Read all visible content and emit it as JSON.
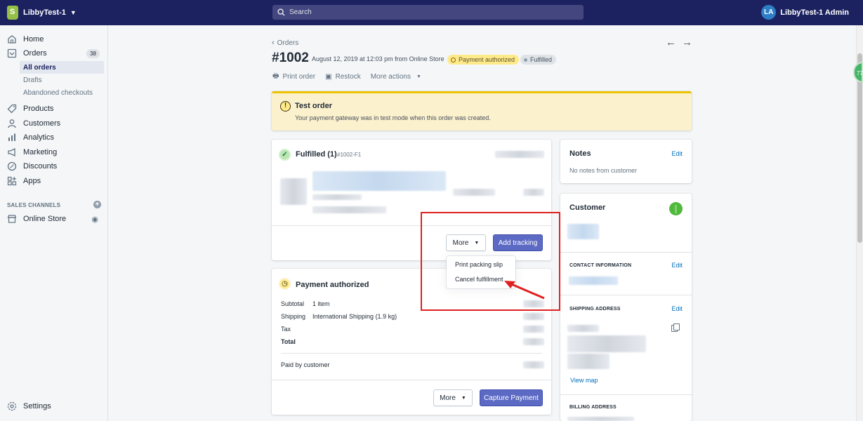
{
  "topbar": {
    "store_name": "LibbyTest-1",
    "search_placeholder": "Search",
    "user_initials": "LA",
    "user_name": "LibbyTest-1 Admin"
  },
  "sidebar": {
    "home": "Home",
    "orders": "Orders",
    "orders_count": "38",
    "all_orders": "All orders",
    "drafts": "Drafts",
    "abandoned": "Abandoned checkouts",
    "products": "Products",
    "customers": "Customers",
    "analytics": "Analytics",
    "marketing": "Marketing",
    "discounts": "Discounts",
    "apps": "Apps",
    "sales_channels": "SALES CHANNELS",
    "online_store": "Online Store",
    "settings": "Settings"
  },
  "header": {
    "breadcrumb": "Orders",
    "order_number": "#1002",
    "order_meta": "August 12, 2019 at 12:03 pm from Online Store",
    "payment_status": "Payment authorized",
    "fulfillment_status": "Fulfilled",
    "print_order": "Print order",
    "restock": "Restock",
    "more_actions": "More actions"
  },
  "test_banner": {
    "title": "Test order",
    "text": "Your payment gateway was in test mode when this order was created."
  },
  "fulfilled_card": {
    "title": "Fulfilled (1)",
    "id": "#1002-F1",
    "more_label": "More",
    "add_tracking": "Add tracking",
    "dropdown_items": [
      "Print packing slip",
      "Cancel fulfillment"
    ]
  },
  "payment_card": {
    "title": "Payment authorized",
    "rows": [
      {
        "label": "Subtotal",
        "value": "1 item"
      },
      {
        "label": "Shipping",
        "value": "International Shipping (1.9 kg)"
      },
      {
        "label": "Tax",
        "value": ""
      },
      {
        "label": "Total",
        "value": ""
      }
    ],
    "paid_by": "Paid by customer",
    "more_label": "More",
    "capture": "Capture Payment"
  },
  "notes_card": {
    "title": "Notes",
    "edit": "Edit",
    "empty": "No notes from customer"
  },
  "customer_card": {
    "title": "Customer",
    "contact_heading": "CONTACT INFORMATION",
    "contact_edit": "Edit",
    "shipping_heading": "SHIPPING ADDRESS",
    "shipping_edit": "Edit",
    "view_map": "View map",
    "billing_heading": "BILLING ADDRESS"
  },
  "colors": {
    "topbar": "#1c2260",
    "primary": "#5c6ac4",
    "annotation_red": "#e02020",
    "warning_banner": "#fcf1cd"
  },
  "float_badge": "77"
}
